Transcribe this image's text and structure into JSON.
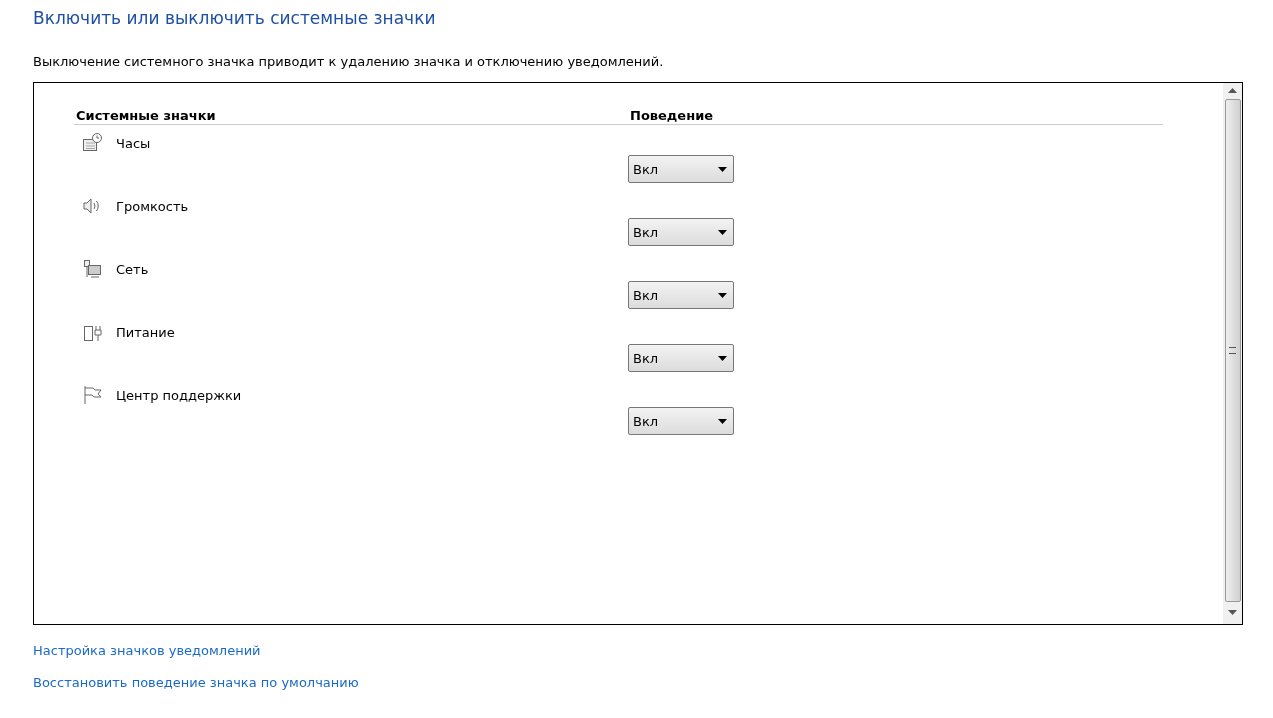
{
  "title": "Включить или выключить системные значки",
  "description": "Выключение системного значка приводит к удалению значка и отключению уведомлений.",
  "table": {
    "columns": [
      "Системные значки",
      "Поведение"
    ],
    "rows": [
      {
        "kind": "clock",
        "name": "Часы",
        "behavior": "Вкл"
      },
      {
        "kind": "volume",
        "name": "Громкость",
        "behavior": "Вкл"
      },
      {
        "kind": "network",
        "name": "Сеть",
        "behavior": "Вкл"
      },
      {
        "kind": "power",
        "name": "Питание",
        "behavior": "Вкл"
      },
      {
        "kind": "flag",
        "name": "Центр поддержки",
        "behavior": "Вкл"
      }
    ]
  },
  "links": [
    "Настройка значков уведомлений",
    "Восстановить поведение значка по умолчанию"
  ]
}
